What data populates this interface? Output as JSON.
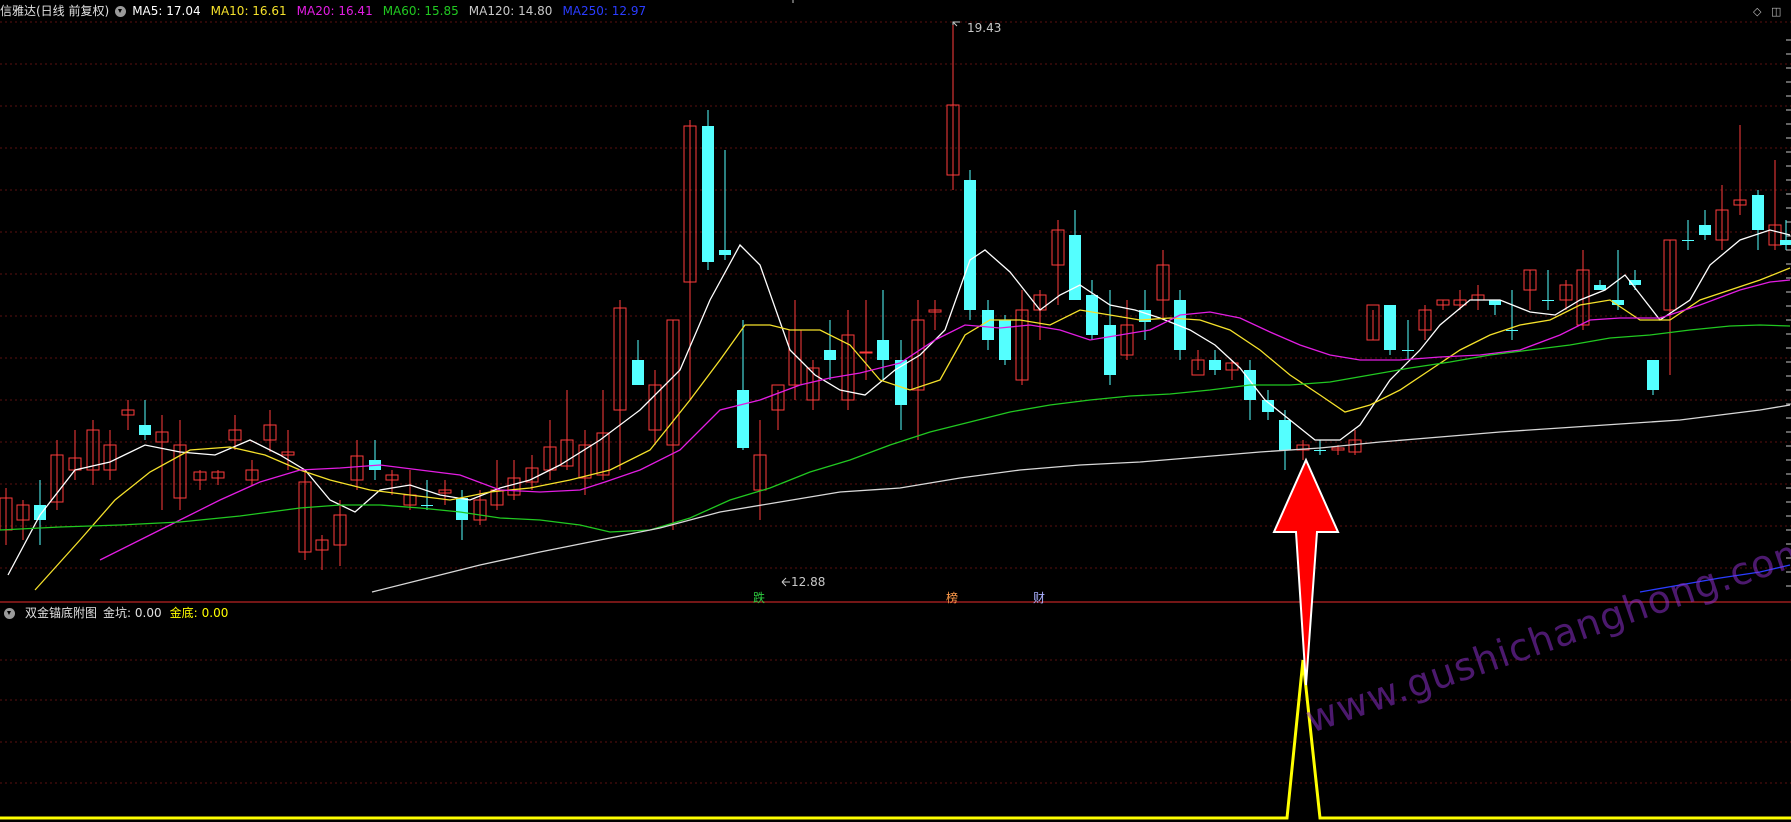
{
  "main_header": {
    "title": "信雅达(日线 前复权)",
    "ma": [
      {
        "label": "MA5: 17.04",
        "color": "#ffffff"
      },
      {
        "label": "MA10: 16.61",
        "color": "#f5e12b"
      },
      {
        "label": "MA20: 16.41",
        "color": "#e21de2"
      },
      {
        "label": "MA60: 15.85",
        "color": "#21c821"
      },
      {
        "label": "MA120: 14.80",
        "color": "#c8c8c8"
      },
      {
        "label": "MA250: 12.97",
        "color": "#2a3cff"
      }
    ]
  },
  "sub_header": {
    "title": "双金锚底附图",
    "jinkeng": "金坑: 0.00",
    "jindi_label": "金底:",
    "jindi_value": "0.00"
  },
  "price_labels": {
    "high": "19.43",
    "low": "12.88"
  },
  "event_tags": [
    {
      "text": "跌",
      "color": "#2ecc40"
    },
    {
      "text": "榜",
      "color": "#ff9b4a"
    },
    {
      "text": "财",
      "color": "#aab0ff"
    }
  ],
  "watermark": "www.gushichanghong.com",
  "colors": {
    "up": "#ff3c3c",
    "down": "#54ffff",
    "grid": "#5a1010",
    "divider": "#9a1e1e",
    "signal": "#ffff00",
    "arrow": "#ff0000"
  },
  "window_controls": [
    "diamond-icon",
    "restore-icon"
  ]
}
